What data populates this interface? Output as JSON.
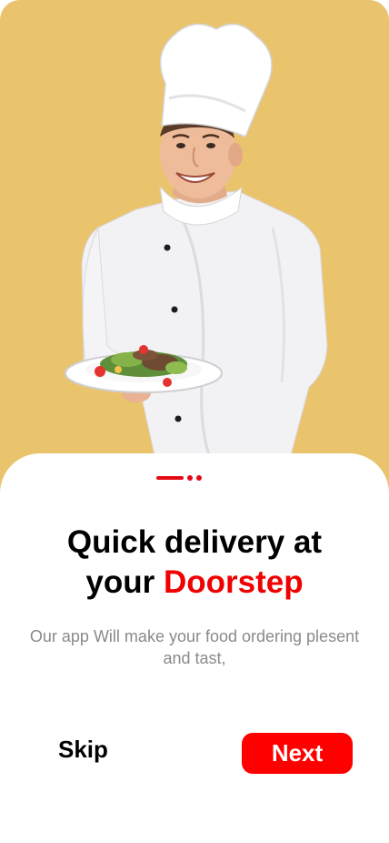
{
  "onboarding": {
    "headline_line1": "Quick delivery at",
    "headline_prefix": "your",
    "headline_accent": "Doorstep",
    "subtitle": "Our app Will make your food ordering plesent and tast,",
    "skip_label": "Skip",
    "next_label": "Next",
    "step_count": 3,
    "active_step": 1
  },
  "colors": {
    "hero_background": "#EAC46C",
    "accent": "#F00000",
    "button": "#FF0000",
    "subtitle_text": "#8a8a8a"
  },
  "hero": {
    "illustration": "chef-holding-salad-plate-image"
  }
}
